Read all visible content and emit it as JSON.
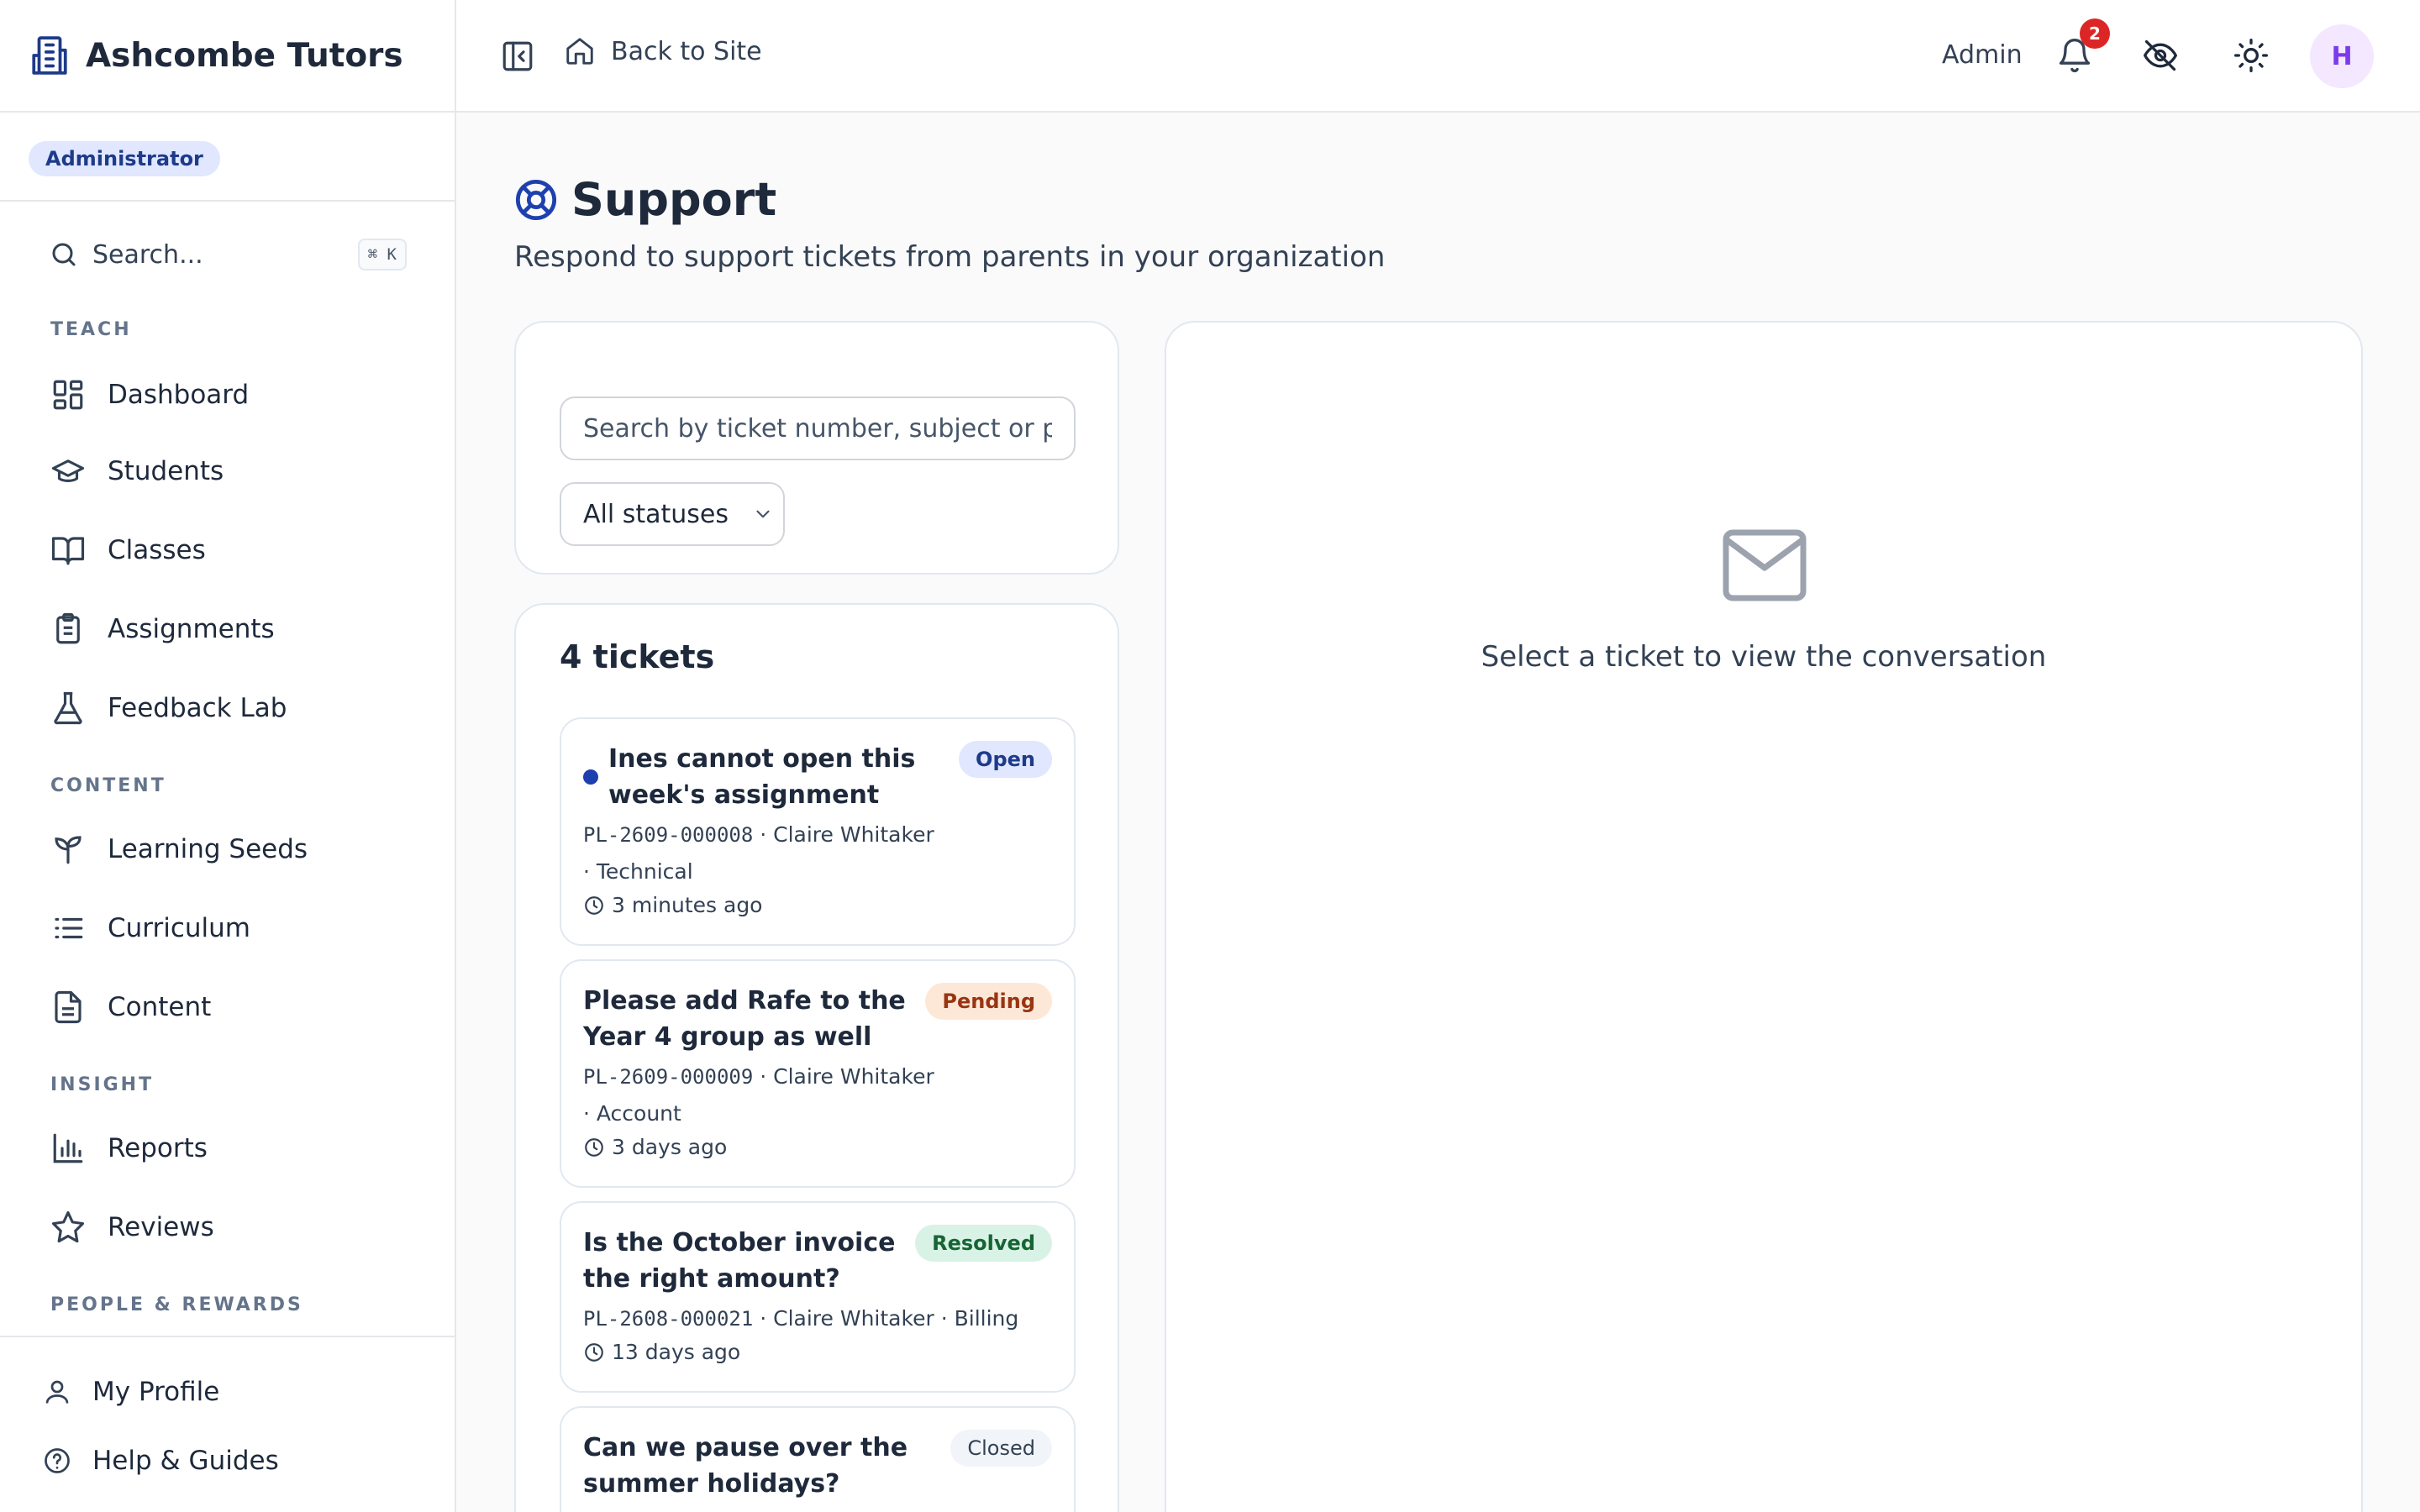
{
  "brand": {
    "name": "Ashcombe Tutors"
  },
  "role_badge": "Administrator",
  "sidebar": {
    "search_label": "Search...",
    "search_shortcut": "⌘ K",
    "sections": {
      "teach": "TEACH",
      "content": "CONTENT",
      "insight": "INSIGHT",
      "people": "PEOPLE & REWARDS"
    },
    "items": [
      {
        "label": "Dashboard",
        "icon": "dashboard-icon"
      },
      {
        "label": "Students",
        "icon": "graduation-cap-icon"
      },
      {
        "label": "Classes",
        "icon": "book-icon"
      },
      {
        "label": "Assignments",
        "icon": "clipboard-icon"
      },
      {
        "label": "Feedback Lab",
        "icon": "flask-icon"
      },
      {
        "label": "Learning Seeds",
        "icon": "sprout-icon"
      },
      {
        "label": "Curriculum",
        "icon": "list-icon"
      },
      {
        "label": "Content",
        "icon": "document-icon"
      },
      {
        "label": "Reports",
        "icon": "bar-chart-icon"
      },
      {
        "label": "Reviews",
        "icon": "star-icon"
      }
    ],
    "bottom": [
      {
        "label": "My Profile",
        "icon": "user-icon"
      },
      {
        "label": "Help & Guides",
        "icon": "help-circle-icon"
      }
    ]
  },
  "topbar": {
    "back_label": "Back to Site",
    "admin_label": "Admin",
    "notification_count": "2",
    "avatar_initial": "H"
  },
  "page": {
    "title": "Support",
    "subtitle": "Respond to support tickets from parents in your organization"
  },
  "filters": {
    "search_placeholder": "Search by ticket number, subject or parent",
    "status_selected": "All statuses"
  },
  "tickets": {
    "count_label": "4 tickets",
    "items": [
      {
        "title": "Ines cannot open this week's assignment",
        "status": "Open",
        "number": "PL-2609-000008",
        "parent": "· Claire Whitaker",
        "category": "· Technical",
        "time": "3 minutes ago",
        "unread": true
      },
      {
        "title": "Please add Rafe to the Year 4 group as well",
        "status": "Pending",
        "number": "PL-2609-000009",
        "parent": "· Claire Whitaker",
        "category": "· Account",
        "time": "3 days ago",
        "unread": false
      },
      {
        "title": "Is the October invoice the right amount?",
        "status": "Resolved",
        "number": "PL-2608-000021",
        "parent": "· Claire Whitaker",
        "category": "· Billing",
        "time": "13 days ago",
        "unread": false
      },
      {
        "title": "Can we pause over the summer holidays?",
        "status": "Closed",
        "number": "",
        "parent": "",
        "category": "",
        "time": "",
        "unread": false
      }
    ]
  },
  "conversation": {
    "empty_text": "Select a ticket to view the conversation"
  },
  "colors": {
    "accent": "#1e40af",
    "badge_red": "#dc2626",
    "avatar_bg": "#f3e8ff",
    "avatar_fg": "#7c3aed"
  }
}
